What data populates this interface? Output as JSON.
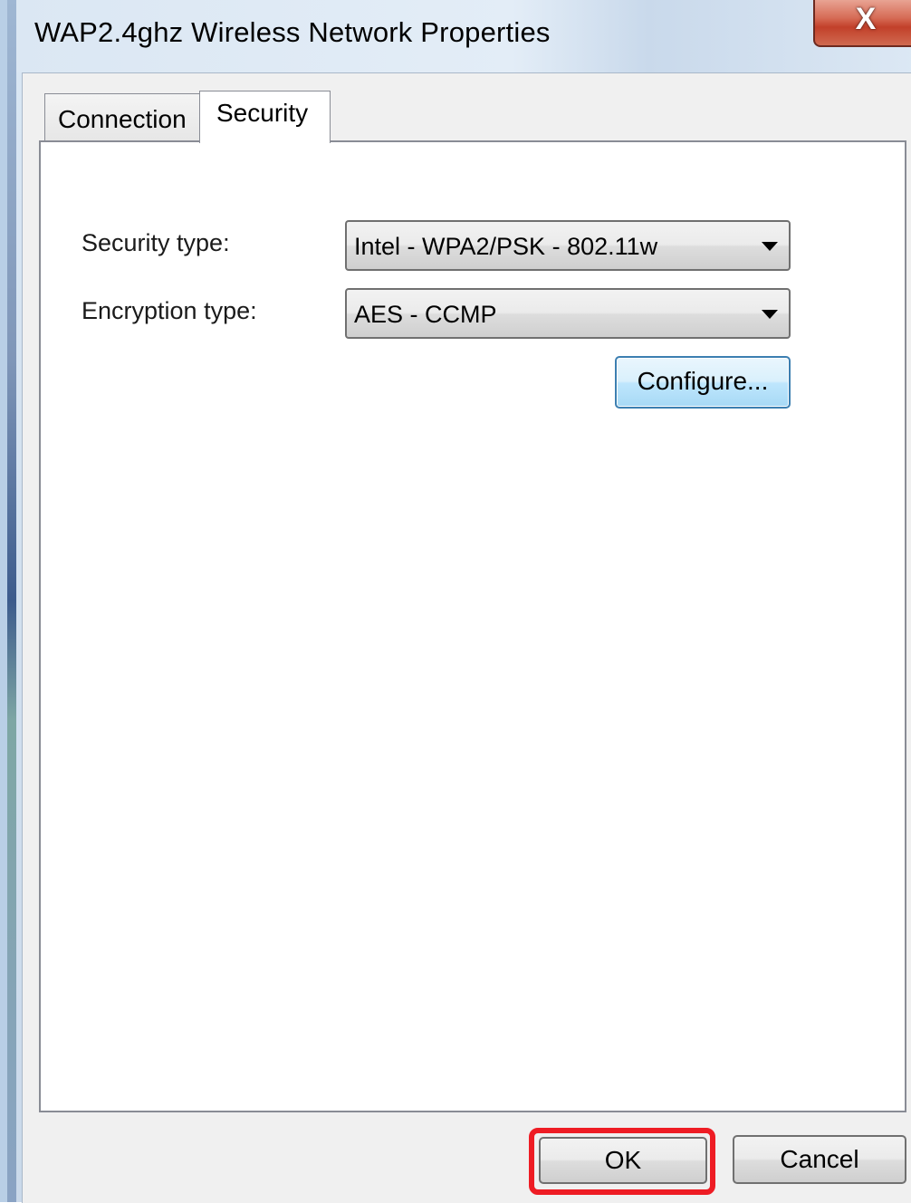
{
  "window": {
    "title": "WAP2.4ghz Wireless Network Properties",
    "close_glyph": "X"
  },
  "tabs": [
    {
      "label": "Connection",
      "selected": false
    },
    {
      "label": "Security",
      "selected": true
    }
  ],
  "security": {
    "security_type_label": "Security type:",
    "security_type_value": "Intel - WPA2/PSK - 802.11w",
    "encryption_type_label": "Encryption type:",
    "encryption_type_value": "AES - CCMP",
    "configure_label": "Configure..."
  },
  "footer": {
    "ok_label": "OK",
    "cancel_label": "Cancel"
  },
  "colors": {
    "highlight": "#ee1c24",
    "configure_focus": "#3c7fb1"
  }
}
